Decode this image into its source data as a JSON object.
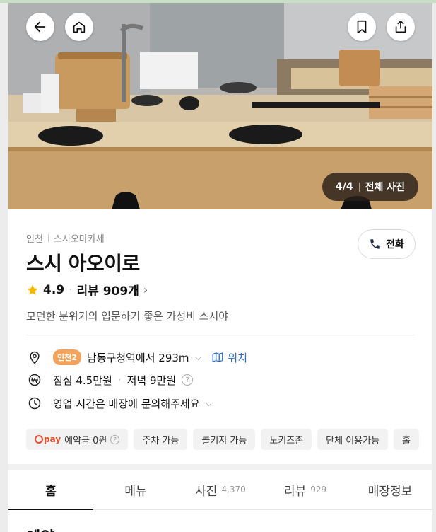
{
  "hero": {
    "photo_index": "4/4",
    "all_photos_label": "전체 사진"
  },
  "top_buttons": {
    "back_icon": "arrow-left-icon",
    "home_icon": "home-icon",
    "bookmark_icon": "bookmark-icon",
    "share_icon": "share-icon"
  },
  "restaurant": {
    "region": "인천",
    "category": "스시오마카세",
    "name": "스시 아오이로",
    "rating": "4.9",
    "review_label": "리뷰 909개",
    "description": "모던한 분위기의 입문하기 좋은 가성비 스시야",
    "call_label": "전화"
  },
  "location": {
    "line_badge": "인천2",
    "text": "남동구청역에서 293m",
    "map_label": "위치"
  },
  "price": {
    "lunch": "점심 4.5만원",
    "dinner": "저녁 9만원"
  },
  "hours": {
    "text": "영업 시간은 매장에 문의해주세요"
  },
  "chips": {
    "pay_brand": "pay",
    "deposit": "예약금 0원",
    "items": [
      "주차 가능",
      "콜키지 가능",
      "노키즈존",
      "단체 이용가능",
      "홀"
    ]
  },
  "tabs": [
    {
      "label": "홈",
      "count": ""
    },
    {
      "label": "메뉴",
      "count": ""
    },
    {
      "label": "사진",
      "count": "4,370"
    },
    {
      "label": "리뷰",
      "count": "929"
    },
    {
      "label": "매장정보",
      "count": ""
    }
  ],
  "section": {
    "heading": "예약"
  },
  "colors": {
    "accent_blue": "#2f6fd6",
    "badge_orange": "#f3a35b",
    "pay_red": "#ea4d2c",
    "star": "#f5b800"
  }
}
